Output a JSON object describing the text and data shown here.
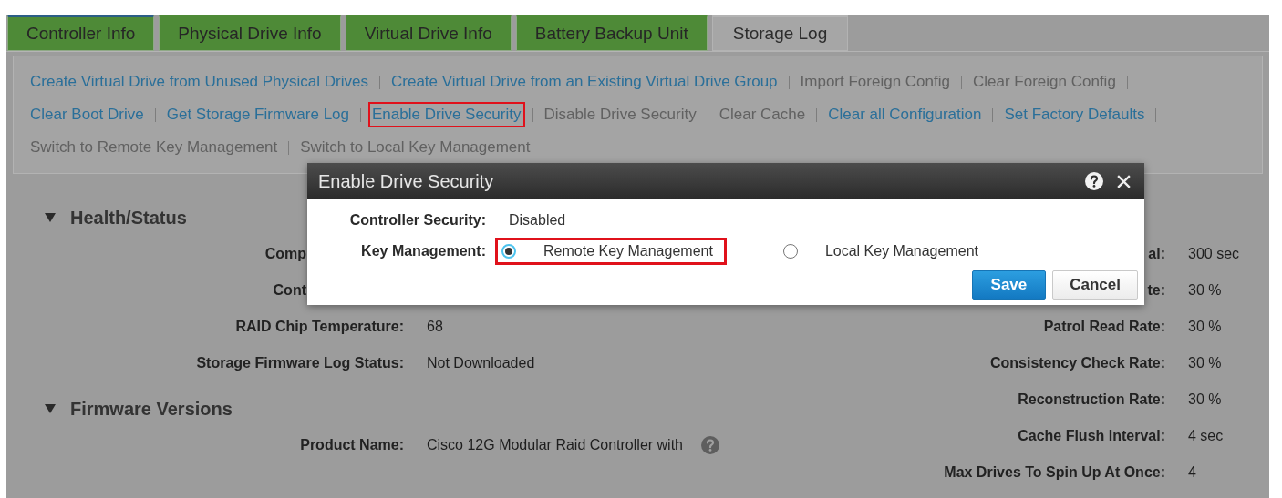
{
  "tabs": [
    {
      "label": "Controller Info",
      "selected": true,
      "disabled": false
    },
    {
      "label": "Physical Drive Info",
      "selected": false,
      "disabled": false
    },
    {
      "label": "Virtual Drive Info",
      "selected": false,
      "disabled": false
    },
    {
      "label": "Battery Backup Unit",
      "selected": false,
      "disabled": false
    },
    {
      "label": "Storage Log",
      "selected": false,
      "disabled": true
    }
  ],
  "actions": [
    {
      "label": "Create Virtual Drive from Unused Physical Drives",
      "enabled": true,
      "highlighted": false
    },
    {
      "label": "Create Virtual Drive from an Existing Virtual Drive Group",
      "enabled": true,
      "highlighted": false
    },
    {
      "label": "Import Foreign Config",
      "enabled": false,
      "highlighted": false
    },
    {
      "label": "Clear Foreign Config",
      "enabled": false,
      "highlighted": false
    },
    {
      "label": "Clear Boot Drive",
      "enabled": true,
      "highlighted": false
    },
    {
      "label": "Get Storage Firmware Log",
      "enabled": true,
      "highlighted": false
    },
    {
      "label": "Enable Drive Security",
      "enabled": true,
      "highlighted": true
    },
    {
      "label": "Disable Drive Security",
      "enabled": false,
      "highlighted": false
    },
    {
      "label": "Clear Cache",
      "enabled": false,
      "highlighted": false
    },
    {
      "label": "Clear all Configuration",
      "enabled": true,
      "highlighted": false
    },
    {
      "label": "Set Factory Defaults",
      "enabled": true,
      "highlighted": false
    },
    {
      "label": "Switch to Remote Key Management",
      "enabled": false,
      "highlighted": false
    },
    {
      "label": "Switch to Local Key Management",
      "enabled": false,
      "highlighted": false
    }
  ],
  "sections": [
    {
      "title": "Health/Status",
      "expanded": true,
      "rows": [
        {
          "label": "Comp"
        },
        {
          "label": "Cont"
        },
        {
          "label": "RAID Chip Temperature:",
          "value": "68"
        },
        {
          "label": "Storage Firmware Log Status:",
          "value": "Not Downloaded"
        }
      ]
    },
    {
      "title": "Firmware Versions",
      "expanded": true,
      "rows": [
        {
          "label": "Product Name:",
          "value": "Cisco 12G Modular Raid Controller with",
          "help": true
        }
      ]
    }
  ],
  "settings": [
    {
      "label": "al:",
      "value": "300 sec"
    },
    {
      "label": "te:",
      "value": "30 %"
    },
    {
      "label": "Patrol Read Rate:",
      "value": "30 %"
    },
    {
      "label": "Consistency Check Rate:",
      "value": "30 %"
    },
    {
      "label": "Reconstruction Rate:",
      "value": "30 %"
    },
    {
      "label": "Cache Flush Interval:",
      "value": "4 sec"
    },
    {
      "label": "Max Drives To Spin Up At Once:",
      "value": "4"
    }
  ],
  "dialog": {
    "title": "Enable Drive Security",
    "controller_security": {
      "label": "Controller Security:",
      "value": "Disabled"
    },
    "key_management": {
      "label": "Key Management:",
      "options": [
        {
          "label": "Remote Key Management",
          "selected": true,
          "highlighted": true
        },
        {
          "label": "Local Key Management",
          "selected": false,
          "highlighted": false
        }
      ]
    },
    "buttons": [
      {
        "label": "Save",
        "kind": "primary"
      },
      {
        "label": "Cancel",
        "kind": "secondary"
      }
    ]
  }
}
